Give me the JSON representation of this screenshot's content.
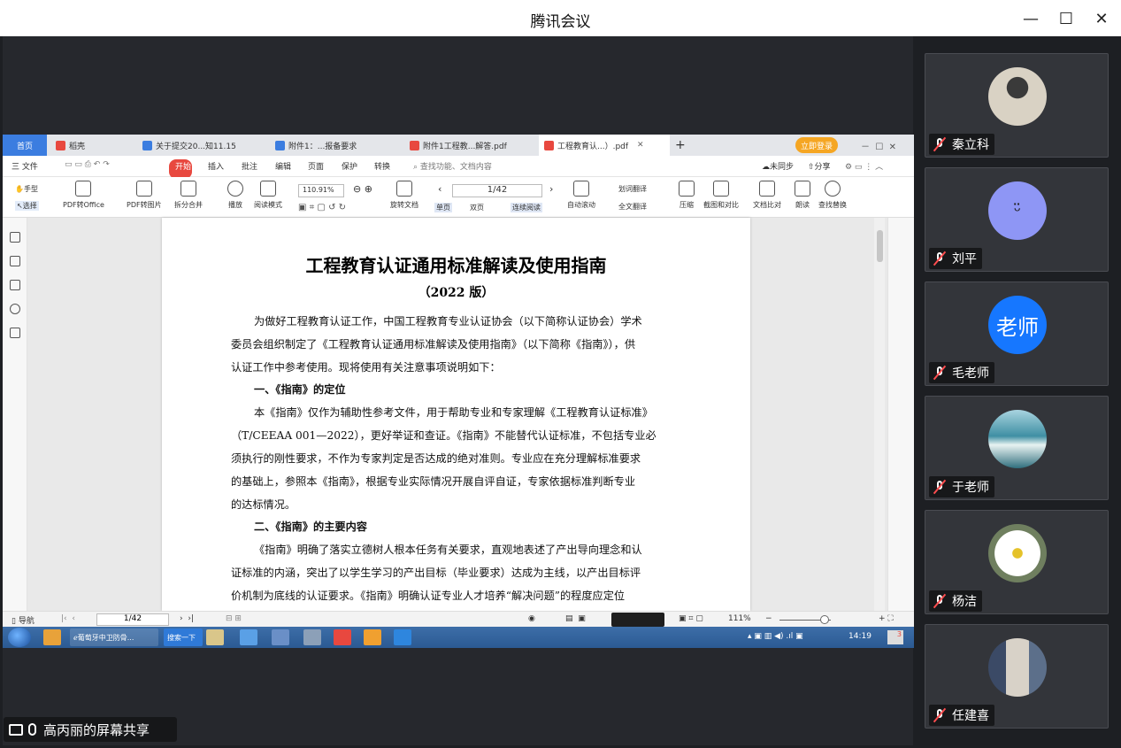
{
  "window": {
    "title": "腾讯会议",
    "minimize": "—",
    "maximize": "☐",
    "close": "✕"
  },
  "share": {
    "caption": "高丙丽的屏幕共享"
  },
  "wps": {
    "tabs": {
      "home": "首页",
      "t1": "稻壳",
      "t2": "关于提交20...知11.15",
      "t3": "附件1：...报备要求",
      "t4": "附件1工程教...解答.pdf",
      "t5": "工程教育认...）.pdf",
      "plus": "+",
      "login": "立即登录"
    },
    "menu": {
      "file": "三 文件",
      "start": "开始",
      "insert": "插入",
      "annotate": "批注",
      "edit": "编辑",
      "page": "页面",
      "protect": "保护",
      "convert": "转换",
      "search": "查找功能、文档内容",
      "unsync": "未同步",
      "share": "分享"
    },
    "ribbon": {
      "hand": "手型",
      "select": "选择",
      "pdf_office": "PDF转Office",
      "pdf_image": "PDF转图片",
      "split_merge": "拆分合并",
      "play": "播放",
      "read_mode": "阅读模式",
      "zoom": "110.91%",
      "rotate": "旋转文档",
      "page": "1/42",
      "single": "单页",
      "double": "双页",
      "continuous": "连续阅读",
      "autoscroll": "自动滚动",
      "translate": "划词翻译",
      "full_translate": "全文翻译",
      "compress": "压缩",
      "screenshot": "截图和对比",
      "compare": "文档比对",
      "read": "朗读",
      "find_replace": "查找替换"
    },
    "document": {
      "title": "工程教育认证通用标准解读及使用指南",
      "subtitle": "（2022 版）",
      "lines": [
        "为做好工程教育认证工作，中国工程教育专业认证协会（以下简称认证协会）学术",
        "委员会组织制定了《工程教育认证通用标准解读及使用指南》（以下简称《指南》），供",
        "认证工作中参考使用。现将使用有关注意事项说明如下：",
        "一、《指南》的定位",
        "本《指南》仅作为辅助性参考文件，用于帮助专业和专家理解《工程教育认证标准》",
        "（T/CEEAA 001—2022），更好举证和查证。《指南》不能替代认证标准，不包括专业必",
        "须执行的刚性要求，不作为专家判定是否达成的绝对准则。专业应在充分理解标准要求",
        "的基础上，参照本《指南》，根据专业实际情况开展自评自证，专家依据标准判断专业",
        "的达标情况。",
        "二、《指南》的主要内容",
        "《指南》明确了落实立德树人根本任务有关要求，直观地表述了产出导向理念和认",
        "证标准的内涵，突出了以学生学习的产出目标（毕业要求）达成为主线，以产出目标评",
        "价机制为底线的认证要求。《指南》明确认证专业人才培养“解决问题”的程度应定位"
      ]
    },
    "status": {
      "nav": "导航",
      "page": "1/42",
      "zoom": "111%"
    },
    "taskbar": {
      "browser": "葡萄牙中卫防骨...",
      "search": "搜索一下",
      "time": "14:19",
      "badge": "3"
    }
  },
  "participants": [
    {
      "name": "秦立科",
      "avatar": "photo-man-in-black",
      "color": "#d8d0c0"
    },
    {
      "name": "刘平",
      "avatar": "cartoon-face",
      "color": "#8e96f5"
    },
    {
      "name": "毛老师",
      "avatar": "text-avatar",
      "avatar_text": "老师",
      "color": "#1677ff"
    },
    {
      "name": "于老师",
      "avatar": "photo-wave",
      "color": "#3f8fa3"
    },
    {
      "name": "杨洁",
      "avatar": "photo-daisy",
      "color": "#7a8a6a"
    },
    {
      "name": "任建喜",
      "avatar": "photo-man-bookshelf",
      "color": "#5c6f8a"
    }
  ]
}
